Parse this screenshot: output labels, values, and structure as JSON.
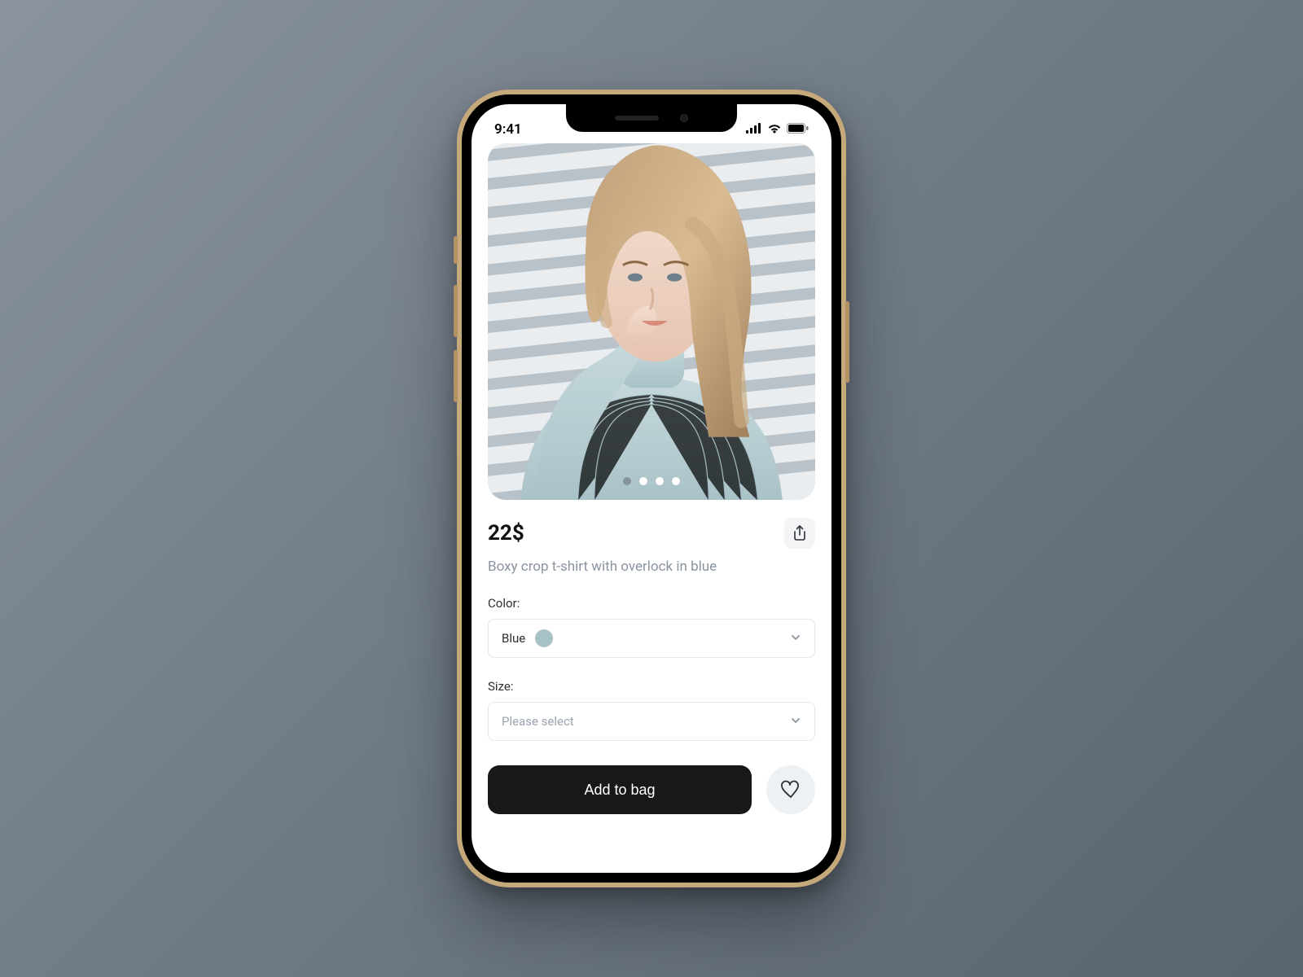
{
  "status": {
    "time": "9:41"
  },
  "carousel": {
    "count": 4,
    "active_index": 0
  },
  "product": {
    "price": "22$",
    "title": "Boxy crop t-shirt with overlock in blue"
  },
  "fields": {
    "color": {
      "label": "Color:",
      "selected": "Blue",
      "swatch_hex": "#a7c3c9"
    },
    "size": {
      "label": "Size:",
      "placeholder": "Please select"
    }
  },
  "actions": {
    "add_to_bag": "Add to bag"
  }
}
